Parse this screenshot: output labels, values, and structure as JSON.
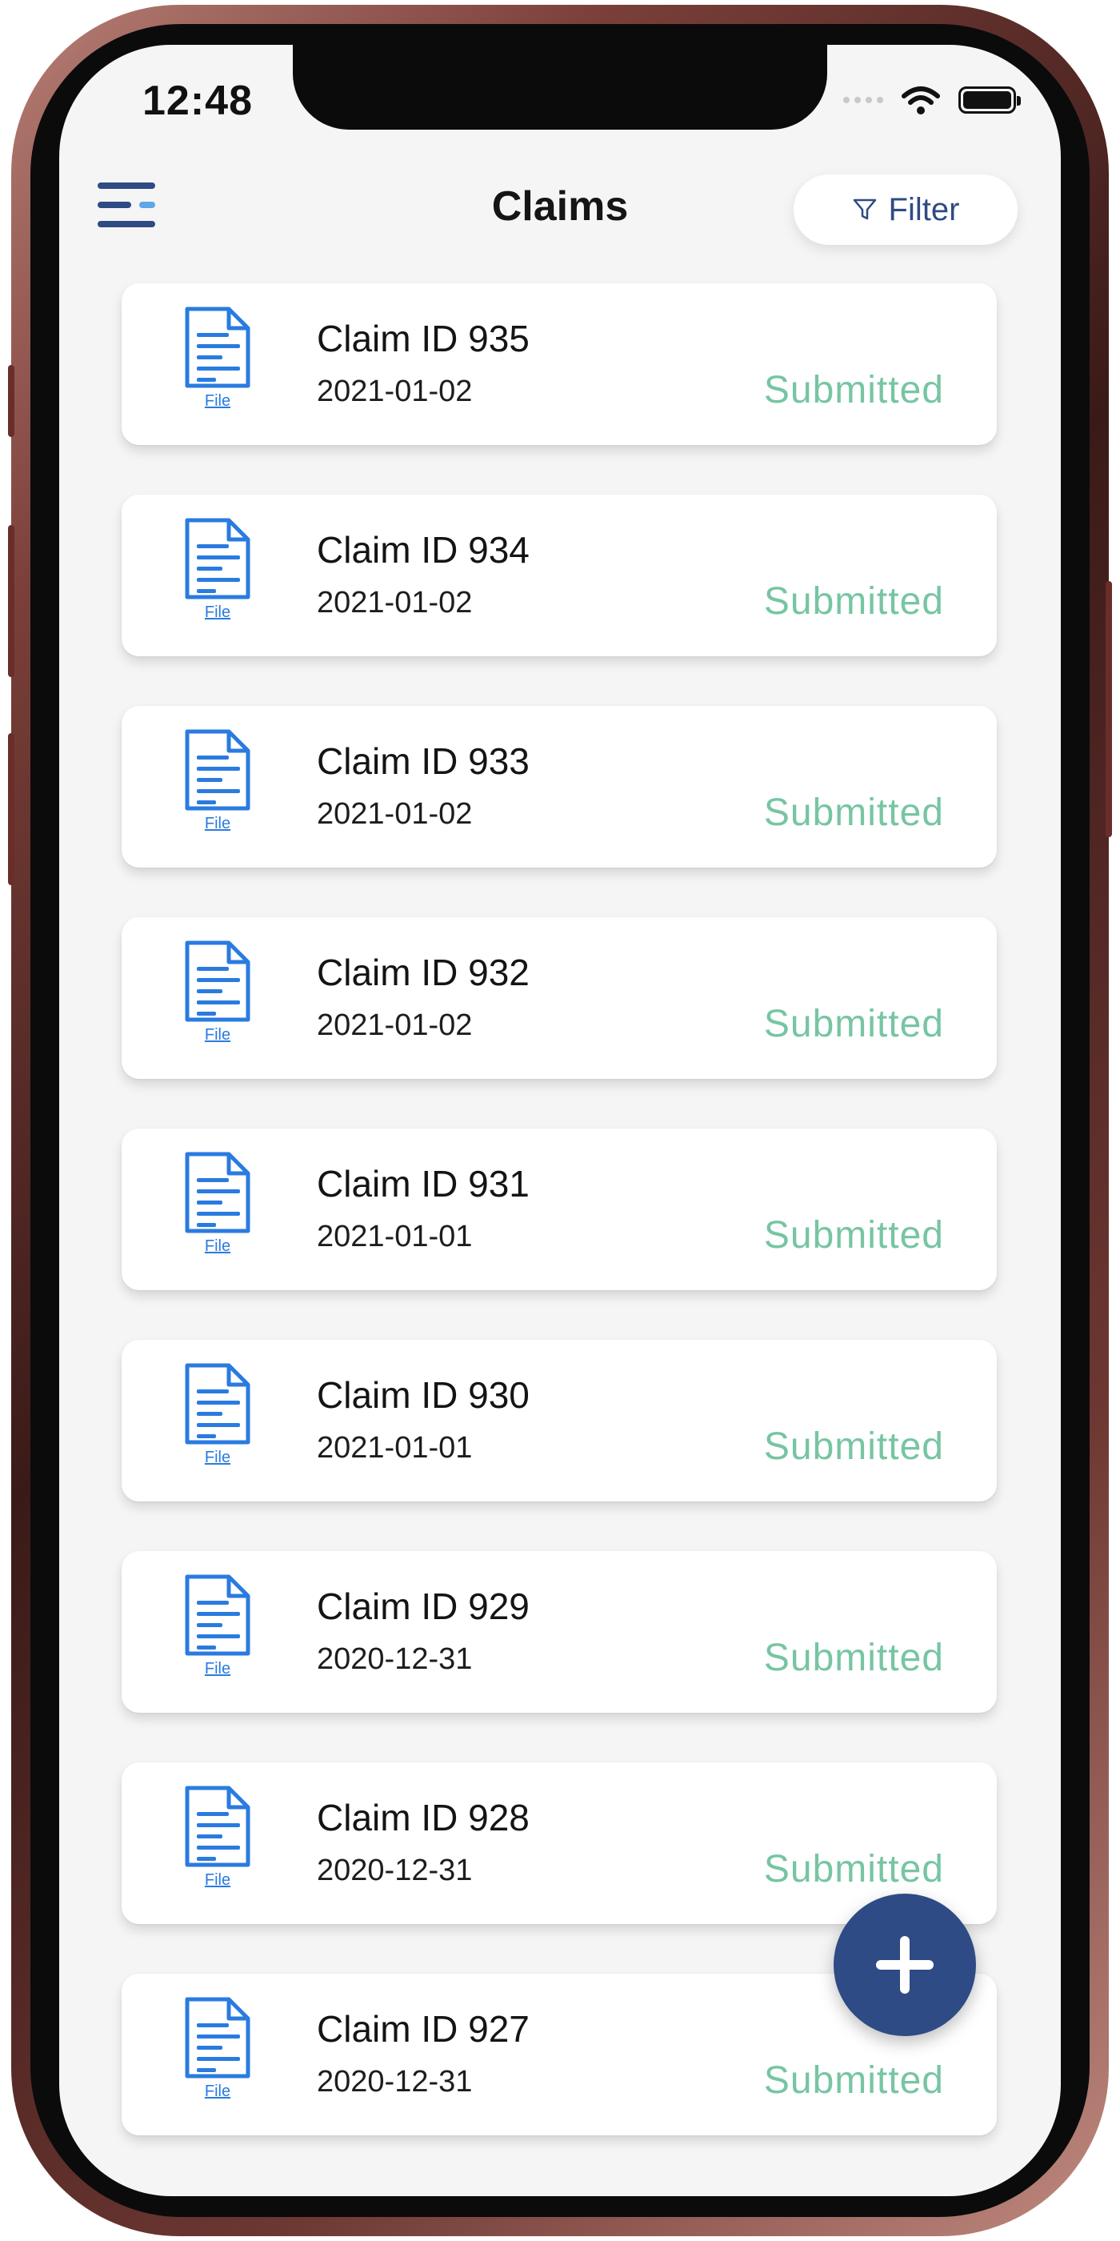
{
  "status_bar": {
    "time": "12:48"
  },
  "header": {
    "title": "Claims",
    "filter_label": "Filter"
  },
  "claims": [
    {
      "title": "Claim ID 935",
      "date": "2021-01-02",
      "status": "Submitted",
      "file_label": "File"
    },
    {
      "title": "Claim ID 934",
      "date": "2021-01-02",
      "status": "Submitted",
      "file_label": "File"
    },
    {
      "title": "Claim ID 933",
      "date": "2021-01-02",
      "status": "Submitted",
      "file_label": "File"
    },
    {
      "title": "Claim ID 932",
      "date": "2021-01-02",
      "status": "Submitted",
      "file_label": "File"
    },
    {
      "title": "Claim ID 931",
      "date": "2021-01-01",
      "status": "Submitted",
      "file_label": "File"
    },
    {
      "title": "Claim ID 930",
      "date": "2021-01-01",
      "status": "Submitted",
      "file_label": "File"
    },
    {
      "title": "Claim ID 929",
      "date": "2020-12-31",
      "status": "Submitted",
      "file_label": "File"
    },
    {
      "title": "Claim ID 928",
      "date": "2020-12-31",
      "status": "Submitted",
      "file_label": "File"
    },
    {
      "title": "Claim ID 927",
      "date": "2020-12-31",
      "status": "Submitted",
      "file_label": "File"
    }
  ],
  "icons": {
    "menu": "menu-icon",
    "filter": "filter-icon",
    "file": "file-document-icon",
    "add": "plus-icon",
    "wifi": "wifi-icon",
    "battery": "battery-icon"
  },
  "colors": {
    "primary": "#2f4b85",
    "status_submitted": "#77c5a2",
    "file_icon": "#2a7be0",
    "screen_background": "#f5f5f6"
  }
}
